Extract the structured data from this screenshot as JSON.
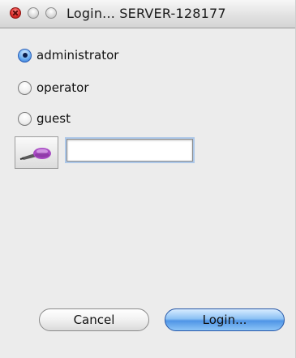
{
  "window": {
    "title": "Login... SERVER-128177"
  },
  "roles": [
    {
      "label": "administrator",
      "selected": true
    },
    {
      "label": "operator",
      "selected": false
    },
    {
      "label": "guest",
      "selected": false
    }
  ],
  "password": {
    "value": "",
    "icon": "key-icon"
  },
  "buttons": {
    "cancel_label": "Cancel",
    "login_label": "Login..."
  },
  "colors": {
    "accent": "#4f95e6",
    "close": "#e0302d"
  }
}
